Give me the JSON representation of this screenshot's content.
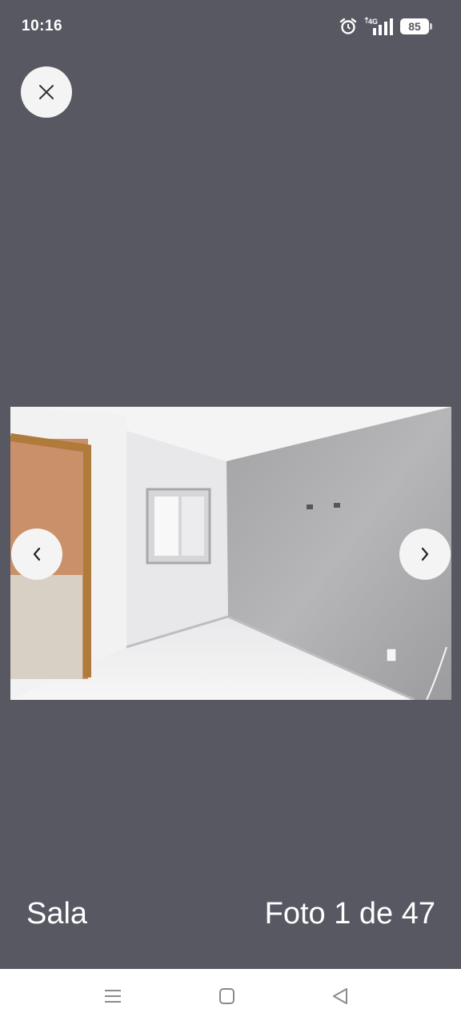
{
  "status_bar": {
    "time": "10:16",
    "network": "4G",
    "battery": "85",
    "icons": [
      "alarm-icon",
      "signal-icon",
      "battery-icon"
    ]
  },
  "viewer": {
    "close_icon": "close-icon",
    "prev_icon": "chevron-left-icon",
    "next_icon": "chevron-right-icon",
    "photo_caption": "Sala",
    "photo_counter": "Foto 1 de 47",
    "background_color": "#575862"
  },
  "system_nav": {
    "icons": [
      "menu-icon",
      "home-icon",
      "back-icon"
    ]
  }
}
